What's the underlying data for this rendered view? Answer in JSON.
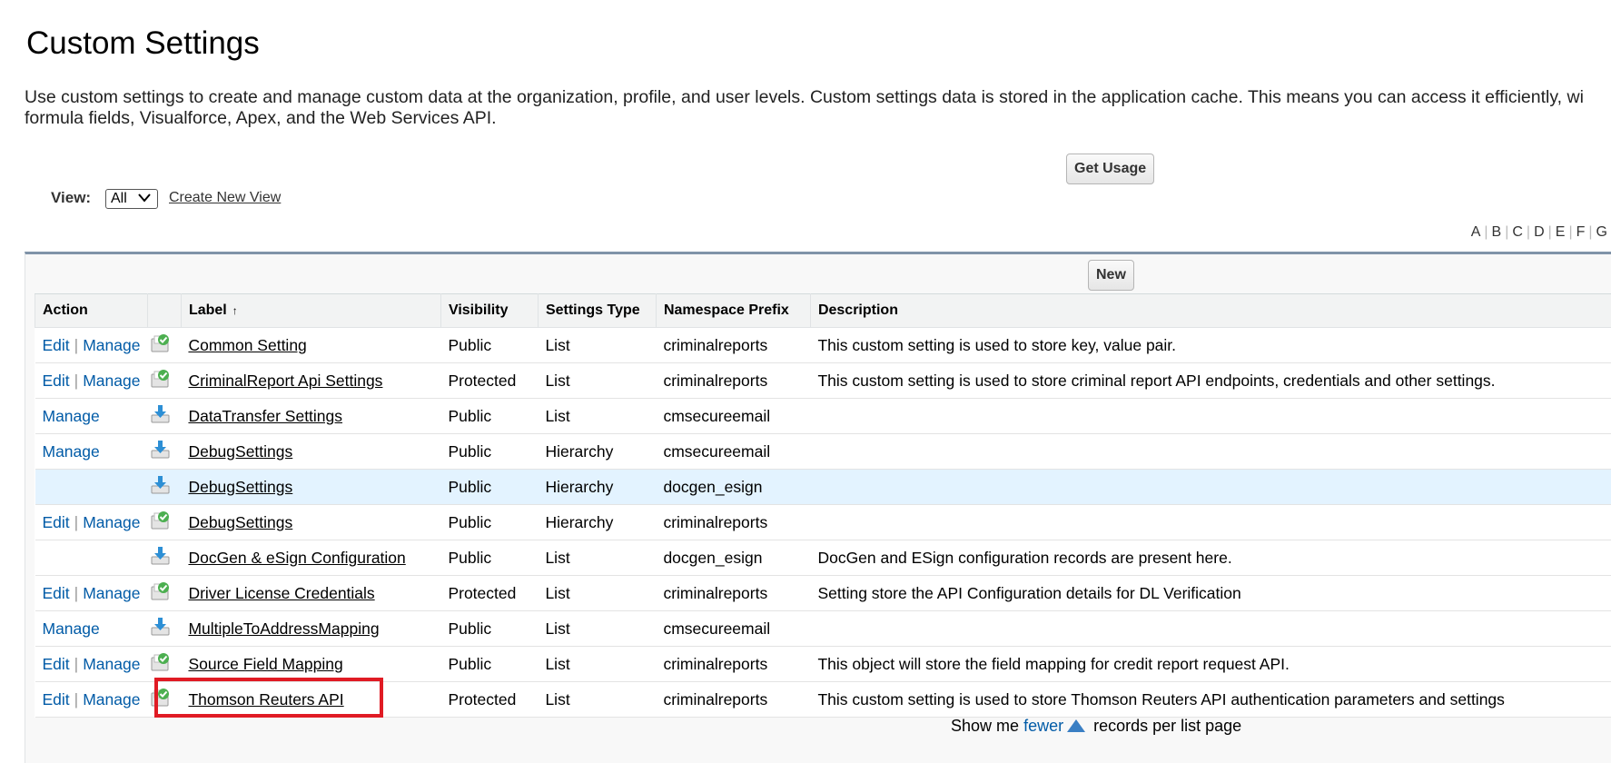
{
  "page": {
    "title": "Custom Settings",
    "intro_line1": "Use custom settings to create and manage custom data at the organization, profile, and user levels. Custom settings data is stored in the application cache. This means you can access it efficiently, wi",
    "intro_line2": "formula fields, Visualforce, Apex, and the Web Services API."
  },
  "toolbar": {
    "get_usage_label": "Get Usage",
    "view_label": "View:",
    "view_selected": "All",
    "create_new_view_label": "Create New View",
    "new_label": "New"
  },
  "alpha_filter": [
    "A",
    "B",
    "C",
    "D",
    "E",
    "F",
    "G"
  ],
  "table": {
    "headers": {
      "action": "Action",
      "label": "Label",
      "visibility": "Visibility",
      "settings_type": "Settings Type",
      "namespace_prefix": "Namespace Prefix",
      "description": "Description"
    },
    "sort_indicator": "↑",
    "rows": [
      {
        "edit": "Edit",
        "manage": "Manage",
        "icon": "check-setting-icon",
        "label": "Common Setting",
        "visibility": "Public",
        "type": "List",
        "namespace": "criminalreports",
        "description": "This custom setting is used to store key, value pair."
      },
      {
        "edit": "Edit",
        "manage": "Manage",
        "icon": "check-setting-icon",
        "label": "CriminalReport Api Settings",
        "visibility": "Protected",
        "type": "List",
        "namespace": "criminalreports",
        "description": "This custom setting is used to store criminal report API endpoints, credentials and other settings."
      },
      {
        "edit": "",
        "manage": "Manage",
        "icon": "installed-package-icon",
        "label": "DataTransfer Settings",
        "visibility": "Public",
        "type": "List",
        "namespace": "cmsecureemail",
        "description": ""
      },
      {
        "edit": "",
        "manage": "Manage",
        "icon": "installed-package-icon",
        "label": "DebugSettings",
        "visibility": "Public",
        "type": "Hierarchy",
        "namespace": "cmsecureemail",
        "description": ""
      },
      {
        "edit": "",
        "manage": "",
        "icon": "installed-package-icon",
        "label": "DebugSettings",
        "visibility": "Public",
        "type": "Hierarchy",
        "namespace": "docgen_esign",
        "description": ""
      },
      {
        "edit": "Edit",
        "manage": "Manage",
        "icon": "check-setting-icon",
        "label": "DebugSettings",
        "visibility": "Public",
        "type": "Hierarchy",
        "namespace": "criminalreports",
        "description": ""
      },
      {
        "edit": "",
        "manage": "",
        "icon": "installed-package-icon",
        "label": "DocGen & eSign Configuration",
        "visibility": "Public",
        "type": "List",
        "namespace": "docgen_esign",
        "description": "DocGen and ESign configuration records are present here."
      },
      {
        "edit": "Edit",
        "manage": "Manage",
        "icon": "check-setting-icon",
        "label": "Driver License Credentials",
        "visibility": "Protected",
        "type": "List",
        "namespace": "criminalreports",
        "description": "Setting store the API Configuration details for DL Verification"
      },
      {
        "edit": "",
        "manage": "Manage",
        "icon": "installed-package-icon",
        "label": "MultipleToAddressMapping",
        "visibility": "Public",
        "type": "List",
        "namespace": "cmsecureemail",
        "description": ""
      },
      {
        "edit": "Edit",
        "manage": "Manage",
        "icon": "check-setting-icon",
        "label": "Source Field Mapping",
        "visibility": "Public",
        "type": "List",
        "namespace": "criminalreports",
        "description": "This object will store the field mapping for credit report request API."
      },
      {
        "edit": "Edit",
        "manage": "Manage",
        "icon": "check-setting-icon",
        "label": "Thomson Reuters API",
        "visibility": "Protected",
        "type": "List",
        "namespace": "criminalreports",
        "description": "This custom setting is used to store Thomson Reuters API authentication parameters and settings"
      }
    ]
  },
  "pager": {
    "prefix": "Show me",
    "link": "fewer",
    "suffix": "records per list page"
  },
  "colors": {
    "link": "#015ba7",
    "highlight_row": "#e3f3ff",
    "annotation_box": "#e01b24"
  }
}
